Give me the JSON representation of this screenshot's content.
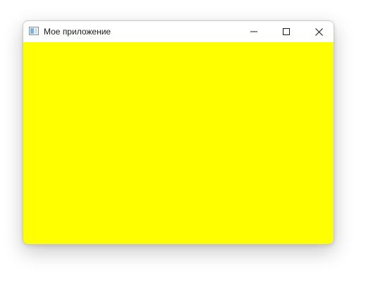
{
  "window": {
    "title": "Мое приложение",
    "icon": "app-window-icon",
    "controls": {
      "minimize_icon": "minimize-icon",
      "maximize_icon": "maximize-icon",
      "close_icon": "close-icon"
    },
    "client_background": "#ffff00"
  }
}
